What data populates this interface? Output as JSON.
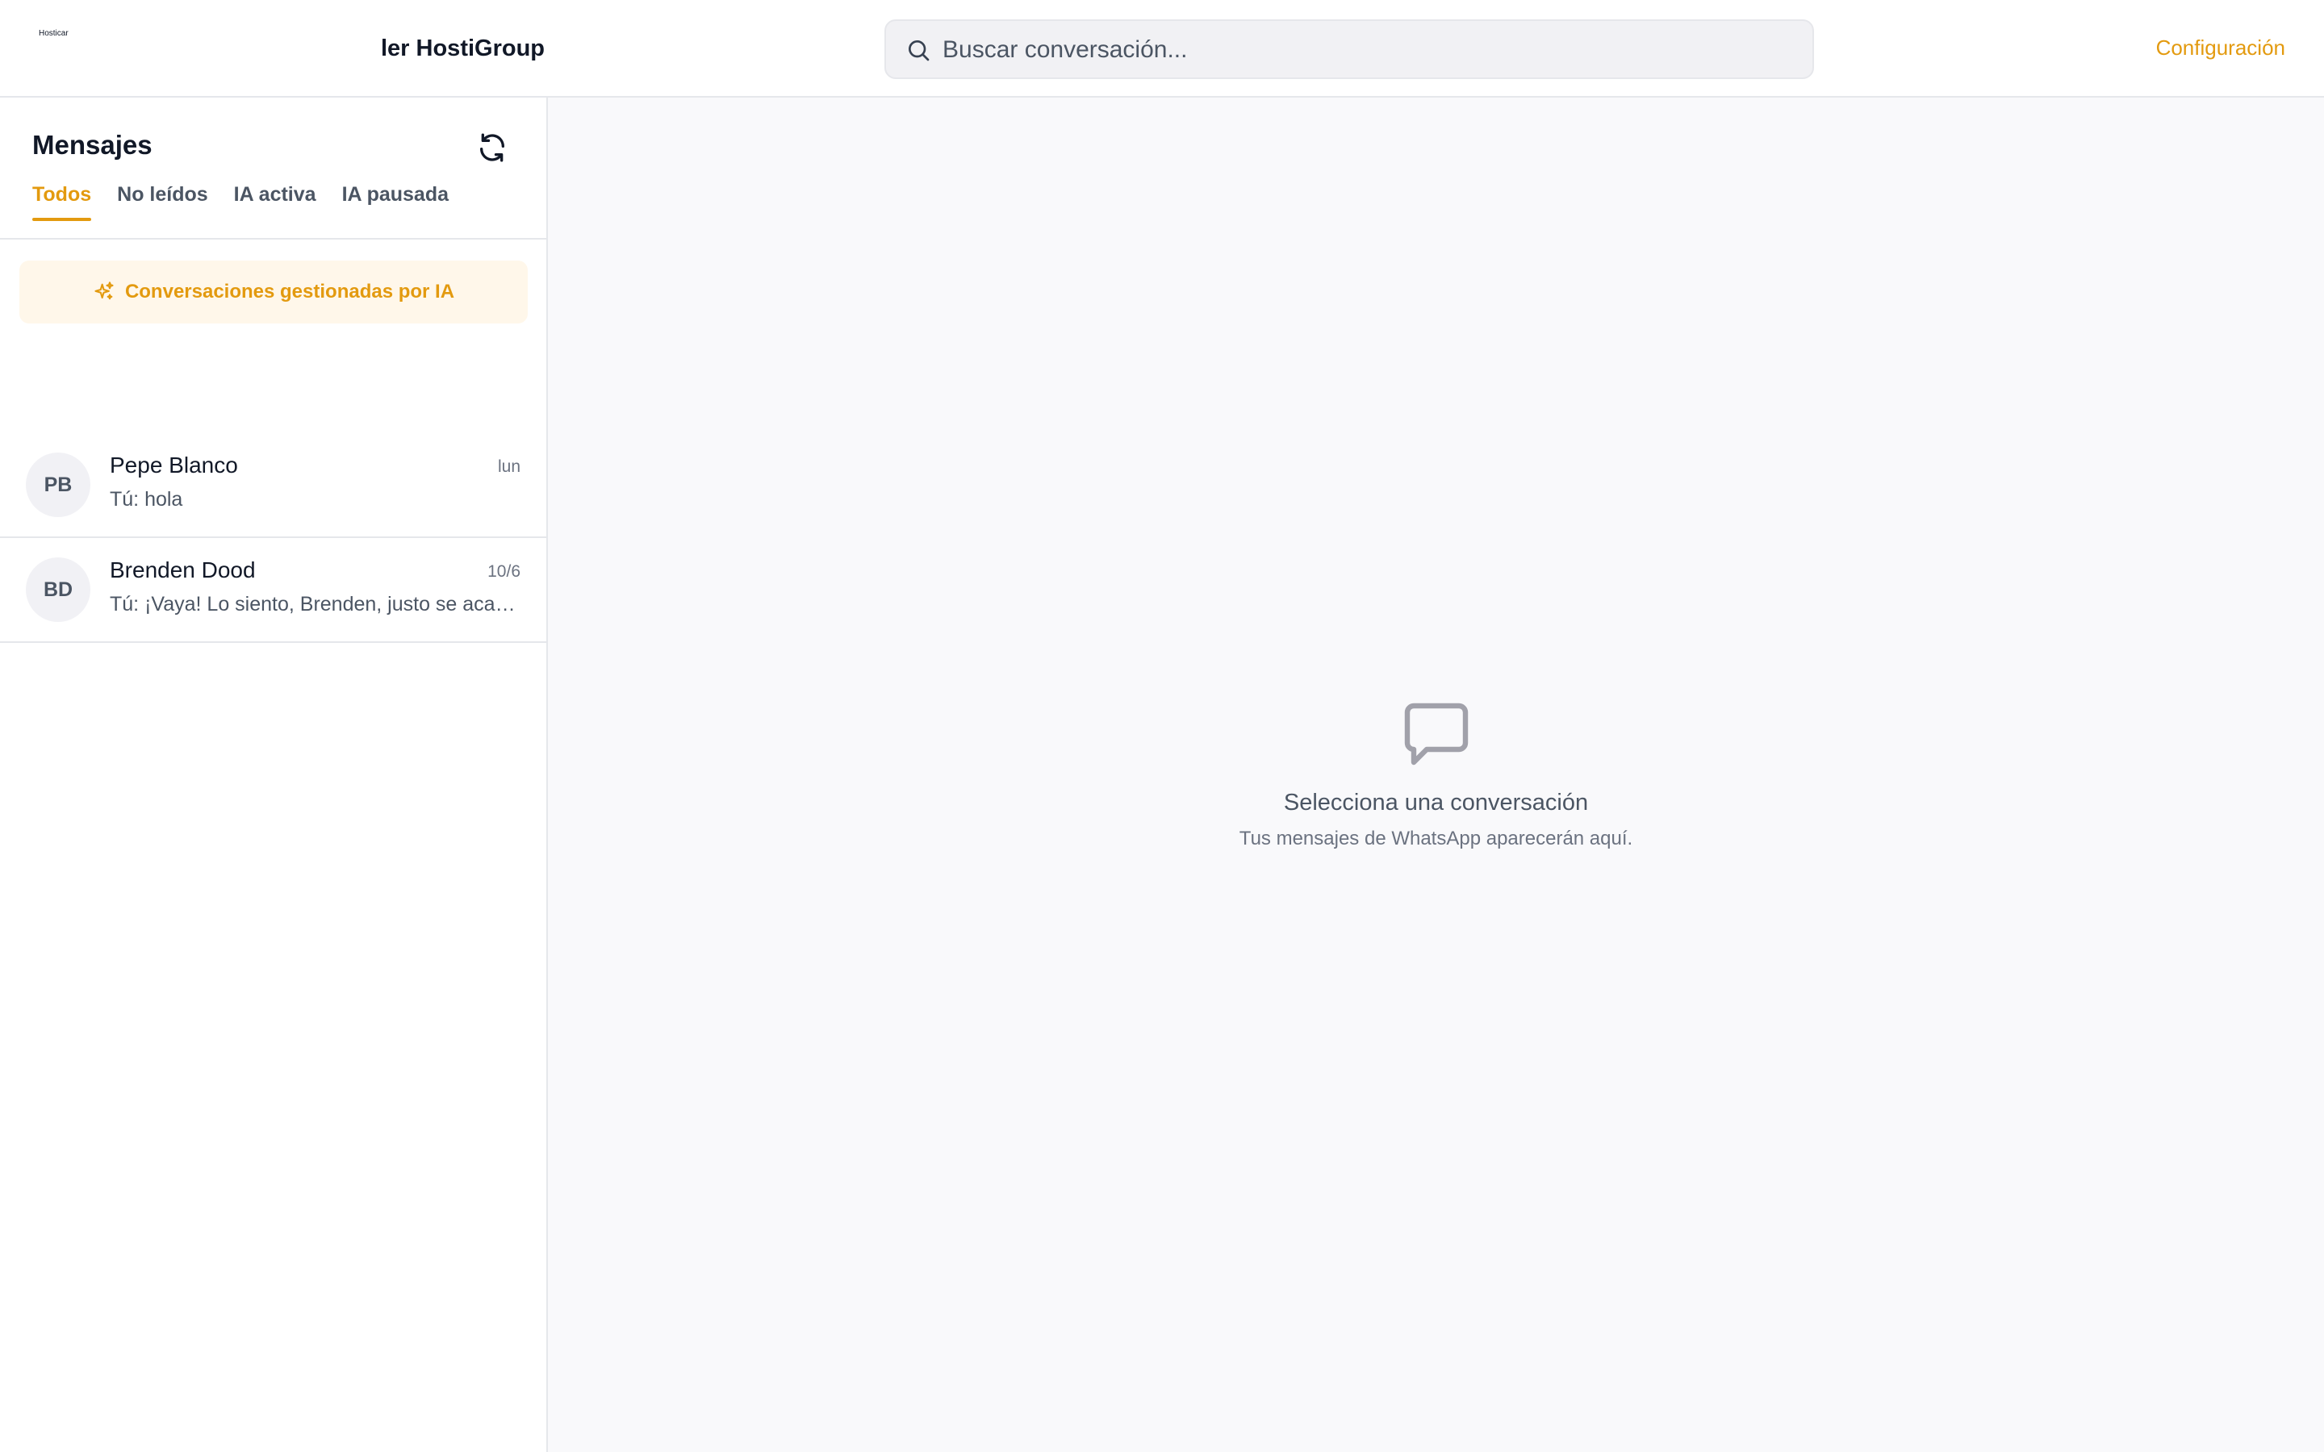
{
  "header": {
    "logo_text": "Hosticar",
    "brand": "ler HostiGroup",
    "search_placeholder": "Buscar conversación...",
    "config_label": "Configuración"
  },
  "sidebar": {
    "title": "Mensajes",
    "tabs": [
      {
        "label": "Todos",
        "active": true
      },
      {
        "label": "No leídos",
        "active": false
      },
      {
        "label": "IA activa",
        "active": false
      },
      {
        "label": "IA pausada",
        "active": false
      }
    ],
    "ai_banner": "Conversaciones gestionadas por IA",
    "conversations": [
      {
        "initials": "PB",
        "name": "Pepe Blanco",
        "time": "lun",
        "preview": "Tú: hola"
      },
      {
        "initials": "BD",
        "name": "Brenden Dood",
        "time": "10/6",
        "preview": "Tú: ¡Vaya! Lo siento, Brenden, justo se acaba de reservar"
      }
    ]
  },
  "main": {
    "empty_title": "Selecciona una conversación",
    "empty_subtitle": "Tus mensajes de WhatsApp aparecerán aquí."
  },
  "icons": {
    "search": "search-icon",
    "refresh": "refresh-icon",
    "sparkles": "sparkles-icon",
    "chat": "message-bubble-icon"
  },
  "colors": {
    "accent": "#e39a0f",
    "banner_bg": "#fff7ea",
    "main_bg": "#f9f9fb"
  }
}
